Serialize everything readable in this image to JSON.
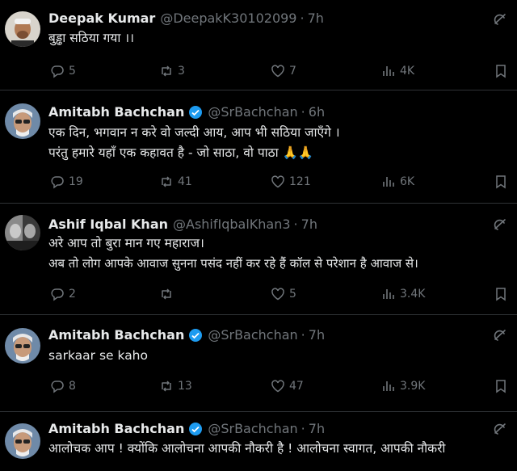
{
  "tweets": [
    {
      "name": "Deepak Kumar",
      "verified": false,
      "handle": "@DeepakK30102099",
      "time": "7h",
      "lines": [
        "बुड्ढा सठिया गया ।।"
      ],
      "replies": "5",
      "reposts": "3",
      "likes": "7",
      "views": "4K",
      "avatar": "avatar-deepak"
    },
    {
      "name": "Amitabh Bachchan",
      "verified": true,
      "handle": "@SrBachchan",
      "time": "6h",
      "lines": [
        "एक दिन, भगवान न करे वो जल्दी आय, आप भी सठिया जाएँगे ।",
        "परंतु हमारे यहाँ एक कहावत है  - जो साठा, वो पाठा 🙏🙏"
      ],
      "replies": "19",
      "reposts": "41",
      "likes": "121",
      "views": "6K",
      "avatar": "avatar-amitabh"
    },
    {
      "name": "Ashif Iqbal Khan",
      "verified": false,
      "handle": "@AshifIqbalKhan3",
      "time": "7h",
      "lines": [
        "अरे आप तो बुरा मान गए महाराज।",
        "अब तो लोग आपके आवाज सुनना पसंद नहीं कर रहे हैं कॉल से परेशान है आवाज से।"
      ],
      "replies": "2",
      "reposts": "",
      "likes": "5",
      "views": "3.4K",
      "avatar": "avatar-ashif"
    },
    {
      "name": "Amitabh Bachchan",
      "verified": true,
      "handle": "@SrBachchan",
      "time": "7h",
      "lines": [
        "sarkaar se kaho"
      ],
      "replies": "8",
      "reposts": "13",
      "likes": "47",
      "views": "3.9K",
      "avatar": "avatar-amitabh"
    },
    {
      "name": "Amitabh Bachchan",
      "verified": true,
      "handle": "@SrBachchan",
      "time": "7h",
      "lines": [
        "आलोचक आप ! क्योंकि आलोचना आपकी नौकरी है ! आलोचना स्वागत, आपकी नौकरी"
      ],
      "replies": "",
      "reposts": "",
      "likes": "",
      "views": "",
      "avatar": "avatar-amitabh"
    }
  ],
  "colors": {
    "background": "#000000",
    "text": "#e7e9ea",
    "muted": "#71767b",
    "verified": "#1d9bf0",
    "divider": "#2f3336"
  },
  "icons": [
    "reply-icon",
    "repost-icon",
    "like-icon",
    "views-icon",
    "bookmark-icon",
    "grok-icon",
    "verified-badge-icon"
  ]
}
